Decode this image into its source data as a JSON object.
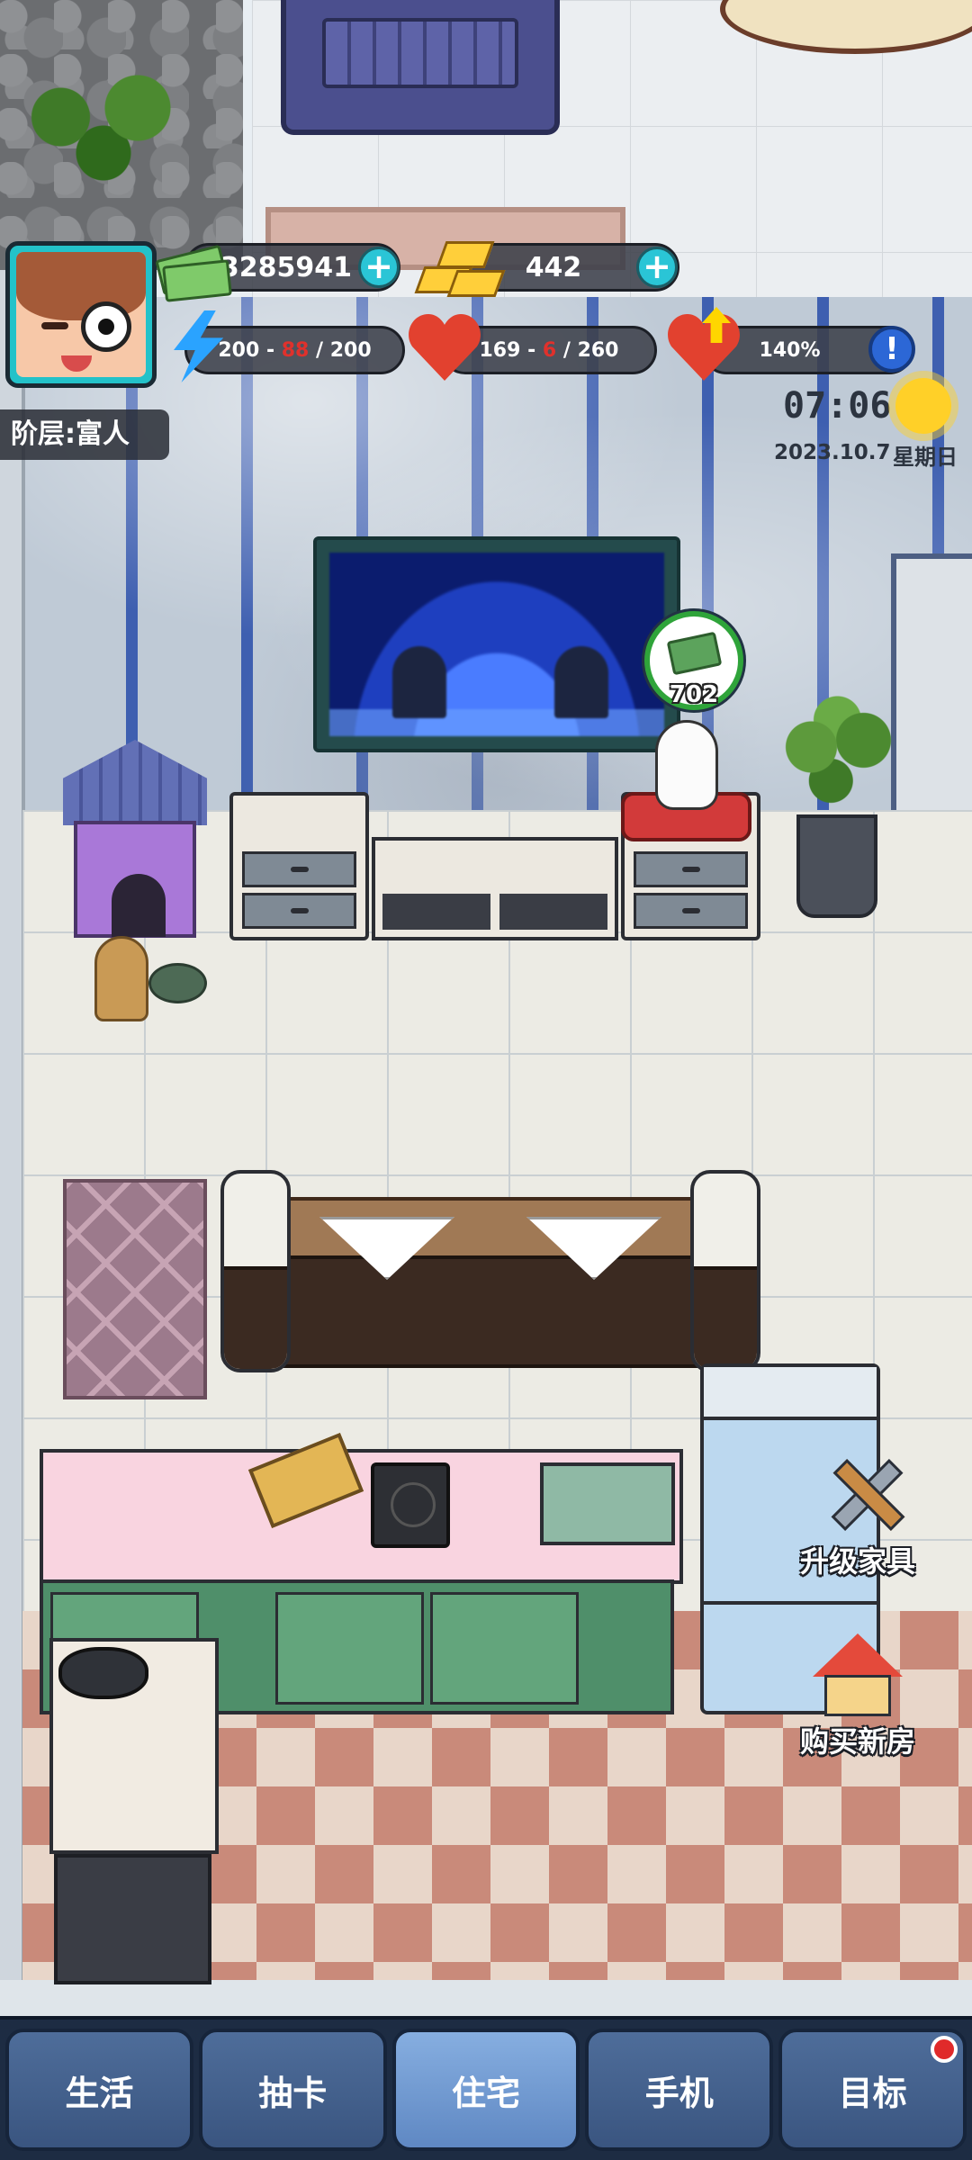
{
  "player": {
    "rank_label": "阶层:富人"
  },
  "resources": {
    "cash": "23285941",
    "gold": "442",
    "energy": {
      "current": "200",
      "cost": "88",
      "max": "200",
      "sep1": " - ",
      "sep2": " / "
    },
    "health": {
      "current": "169",
      "cost": "6",
      "max": "260",
      "sep1": " - ",
      "sep2": " / "
    },
    "bonus_percent": "140%"
  },
  "clock": {
    "time": "07:06",
    "date": "2023.10.7",
    "weekday": "星期日"
  },
  "scene": {
    "lucky_cat_income": "702"
  },
  "side_actions": {
    "upgrade_furniture": "升级家具",
    "buy_new_house": "购买新房"
  },
  "bottom_nav": {
    "tabs": [
      "生活",
      "抽卡",
      "住宅",
      "手机",
      "目标"
    ],
    "active_tab": "住宅"
  },
  "colors": {
    "accent_cyan": "#2ac5d6",
    "nav_bg": "#1d2c43",
    "alert_red": "#e02a2a"
  }
}
